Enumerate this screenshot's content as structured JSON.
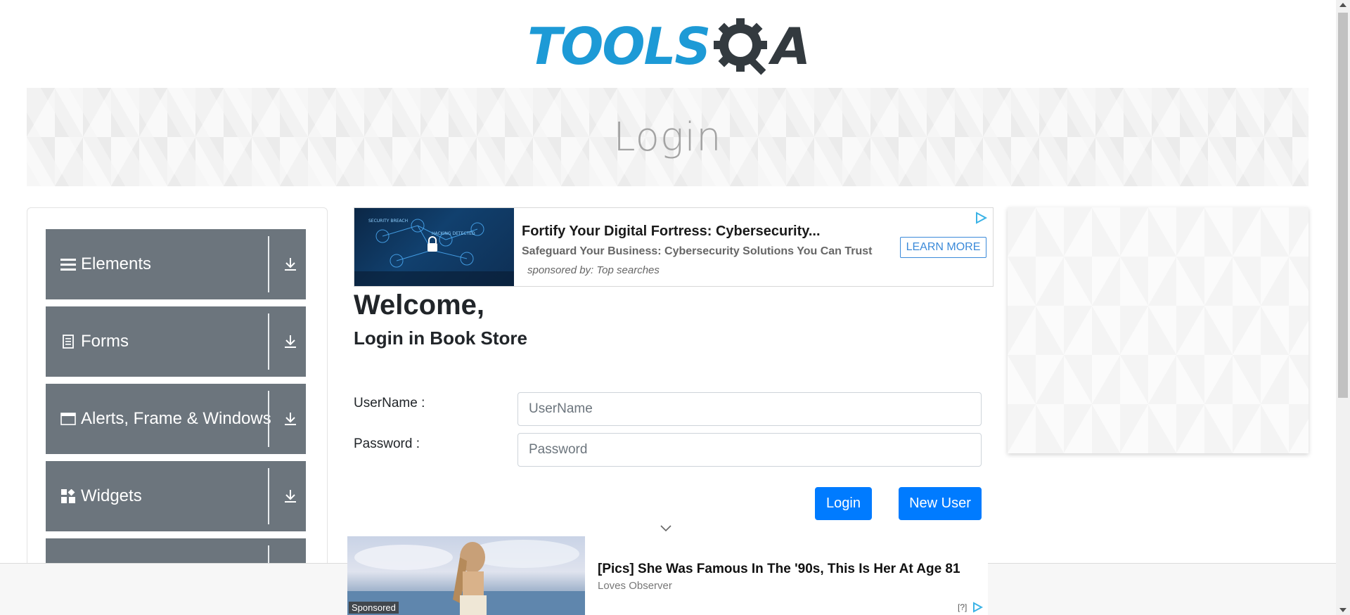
{
  "header": {
    "logo_text": "TOOLS",
    "logo_suffix": "A"
  },
  "banner": {
    "title": "Login"
  },
  "sidebar": {
    "groups": [
      {
        "label": "Elements",
        "icon": "hamburger-icon"
      },
      {
        "label": "Forms",
        "icon": "document-icon"
      },
      {
        "label": "Alerts, Frame & Windows",
        "icon": "window-icon"
      },
      {
        "label": "Widgets",
        "icon": "widgets-icon"
      },
      {
        "label": "",
        "icon": ""
      }
    ]
  },
  "ad_top": {
    "title": "Fortify Your Digital Fortress: Cybersecurity...",
    "subtitle": "Safeguard Your Business: Cybersecurity Solutions You Can Trust",
    "sponsor": "sponsored by: Top searches",
    "cta": "LEARN MORE",
    "image_labels": [
      "SECURITY BREACH",
      "HACKING DETECTED"
    ]
  },
  "main": {
    "welcome": "Welcome,",
    "subtitle": "Login in Book Store",
    "username_label": "UserName :",
    "username_placeholder": "UserName",
    "password_label": "Password :",
    "password_placeholder": "Password",
    "login_button": "Login",
    "new_user_button": "New User"
  },
  "bottom_ad": {
    "tag": "Sponsored",
    "title": "[Pics] She Was Famous In The '90s, This Is Her At Age 81",
    "source": "Loves Observer",
    "info": "[?]"
  },
  "colors": {
    "primary": "#007bff",
    "sidebar_bg": "#6c757d",
    "logo_blue": "#1d9ad6",
    "logo_dark": "#333a3f"
  }
}
